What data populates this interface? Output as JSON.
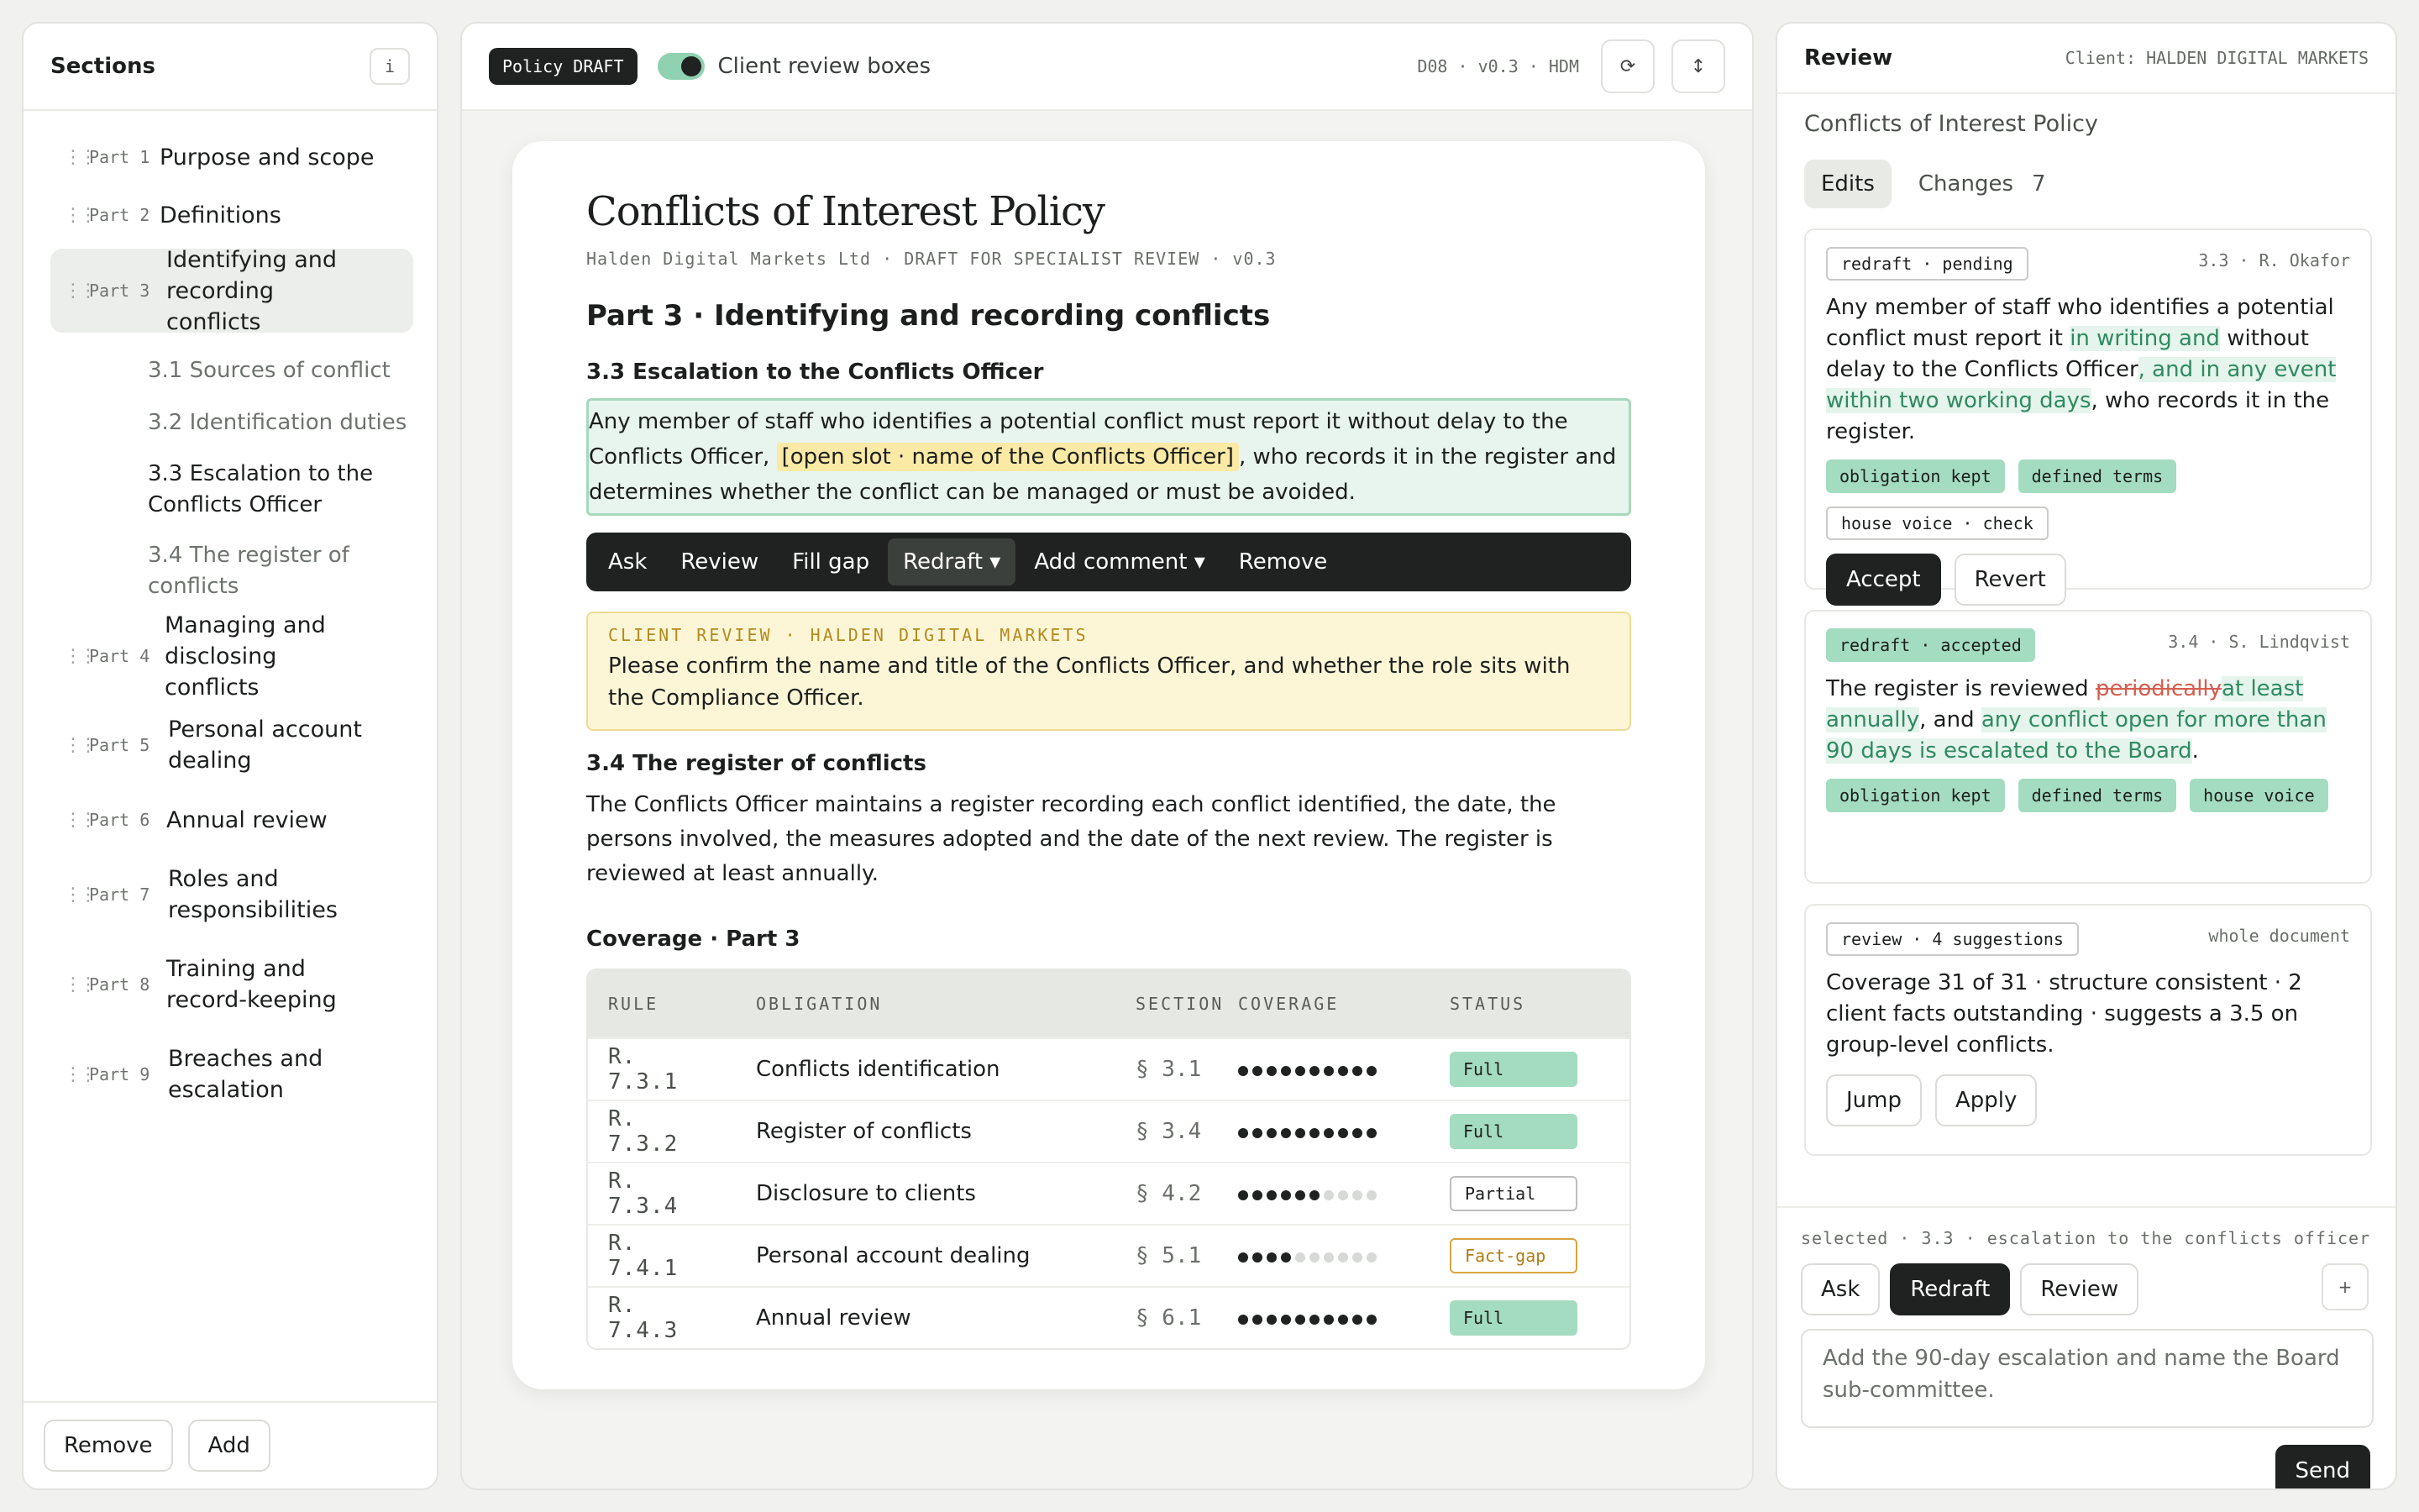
{
  "sections": {
    "title": "Sections",
    "info_label": "i",
    "parts": [
      {
        "label": "Part 1",
        "title": "Purpose and scope"
      },
      {
        "label": "Part 2",
        "title": "Definitions"
      },
      {
        "label": "Part 3",
        "title": "Identifying and recording conflicts",
        "active": true
      },
      {
        "label": "Part 4",
        "title": "Managing and disclosing conflicts"
      },
      {
        "label": "Part 5",
        "title": "Personal account dealing"
      },
      {
        "label": "Part 6",
        "title": "Annual review"
      },
      {
        "label": "Part 7",
        "title": "Roles and responsibilities"
      },
      {
        "label": "Part 8",
        "title": "Training and record-keeping"
      },
      {
        "label": "Part 9",
        "title": "Breaches and escalation"
      }
    ],
    "subsections": [
      {
        "title": "3.1 Sources of conflict"
      },
      {
        "title": "3.2 Identification duties"
      },
      {
        "title": "3.3 Escalation to the Conflicts Officer",
        "selected": true
      },
      {
        "title": "3.4 The register of conflicts"
      }
    ],
    "remove_label": "Remove",
    "add_label": "Add"
  },
  "editor": {
    "badge": "Policy DRAFT",
    "toggle_label": "Client review boxes",
    "doc_meta": "D08 · v0.3 · HDM",
    "refresh_icon": "⟳",
    "sort_icon": "↕",
    "doc_title": "Conflicts of Interest Policy",
    "doc_subtitle": "Halden Digital Markets Ltd · DRAFT FOR SPECIALIST REVIEW · v0.3",
    "part_heading": "Part 3 · Identifying and recording conflicts",
    "sec33_heading": "3.3 Escalation to the Conflicts Officer",
    "sec33_text_a": "Any member of staff who identifies a potential conflict must report it without delay to the Conflicts Officer, ",
    "sec33_slot": "[open slot · name of the Conflicts Officer]",
    "sec33_text_b": ", who records it in the register and determines whether the conflict can be managed or must be avoided.",
    "toolbar": [
      "Ask",
      "Review",
      "Fill gap",
      "Redraft ▾",
      "Add comment ▾",
      "Remove"
    ],
    "client_note_label": "CLIENT REVIEW · HALDEN DIGITAL MARKETS",
    "client_note_text": "Please confirm the name and title of the Conflicts Officer, and whether the role sits with the Compliance Officer.",
    "sec34_heading": "3.4 The register of conflicts",
    "sec34_text": "The Conflicts Officer maintains a register recording each conflict identified, the date, the persons involved, the measures adopted and the date of the next review. The register is reviewed at least annually.",
    "coverage_heading": "Coverage · Part 3",
    "coverage_headers": [
      "RULE",
      "OBLIGATION",
      "SECTION",
      "COVERAGE",
      "STATUS"
    ],
    "coverage_rows": [
      {
        "rule": "R. 7.3.1",
        "obligation": "Conflicts identification",
        "section": "§ 3.1",
        "coverage": 10,
        "status": "Full"
      },
      {
        "rule": "R. 7.3.2",
        "obligation": "Register of conflicts",
        "section": "§ 3.4",
        "coverage": 10,
        "status": "Full"
      },
      {
        "rule": "R. 7.3.4",
        "obligation": "Disclosure to clients",
        "section": "§ 4.2",
        "coverage": 6,
        "status": "Partial"
      },
      {
        "rule": "R. 7.4.1",
        "obligation": "Personal account dealing",
        "section": "§ 5.1",
        "coverage": 4,
        "status": "Fact-gap"
      },
      {
        "rule": "R. 7.4.3",
        "obligation": "Annual review",
        "section": "§ 6.1",
        "coverage": 10,
        "status": "Full"
      }
    ]
  },
  "review": {
    "title": "Review",
    "client": "Client: HALDEN DIGITAL MARKETS",
    "doc_title": "Conflicts of Interest Policy",
    "tab_edits": "Edits",
    "tab_changes": "Changes",
    "changes_count": "7",
    "card1": {
      "tag": "redraft · pending",
      "meta": "3.3 · R. Okafor",
      "t1": "Any member of staff who identifies a potential conflict must report it ",
      "ins1": "in writing and",
      "t2": " without delay to the Conflicts Officer",
      "ins2": ", and in any event within two working days",
      "t3": ", who records it in the register.",
      "checks": [
        "obligation kept",
        "defined terms"
      ],
      "check_outline": "house voice · check",
      "accept": "Accept",
      "revert": "Revert"
    },
    "card2": {
      "tag": "redraft · accepted",
      "meta": "3.4 · S. Lindqvist",
      "t1": "The register is reviewed ",
      "del1": "periodically",
      "ins1": "at least annually",
      "t2": ", and ",
      "ins2": "any conflict open for more than 90 days is escalated to the Board",
      "t3": ".",
      "checks": [
        "obligation kept",
        "defined terms",
        "house voice"
      ]
    },
    "card3": {
      "tag": "review · 4 suggestions",
      "meta": "whole document",
      "text": "Coverage 31 of 31 · structure consistent · 2 client facts outstanding · suggests a 3.5 on group-level conflicts.",
      "jump": "Jump",
      "apply": "Apply"
    },
    "selected": "selected · 3.3 · escalation to the conflicts officer",
    "mode_ask": "Ask",
    "mode_redraft": "Redraft",
    "mode_review": "Review",
    "plus": "+",
    "prompt_value": "Add the 90-day escalation and name the Board sub-committee.",
    "send": "Send"
  },
  "colors": {
    "accent_green": "#a4dcc1",
    "dark": "#1f2220",
    "slot_yellow": "#fbeaa5",
    "fact_gap": "#d8a53c",
    "deletion": "#d65e4e",
    "insertion": "#2f8a60"
  }
}
